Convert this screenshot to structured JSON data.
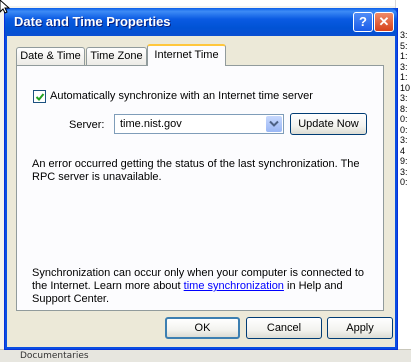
{
  "window": {
    "title": "Date and Time Properties",
    "help_label": "?",
    "close_label": "✕"
  },
  "tabs": [
    {
      "label": "Date & Time",
      "active": false
    },
    {
      "label": "Time Zone",
      "active": false
    },
    {
      "label": "Internet Time",
      "active": true
    }
  ],
  "internet_time": {
    "auto_sync_label": "Automatically synchronize with an Internet time server",
    "auto_sync_checked": true,
    "server_label": "Server:",
    "server_value": "time.nist.gov",
    "update_now_label": "Update Now",
    "error_message": "An error occurred getting the status of the last synchronization.  The RPC server is unavailable.",
    "sync_note_before": "Synchronization can occur only when your computer is connected to the Internet.  Learn more about ",
    "sync_note_link": "time synchronization",
    "sync_note_after": " in Help and Support Center."
  },
  "footer": {
    "ok_label": "OK",
    "cancel_label": "Cancel",
    "apply_label": "Apply"
  },
  "background": {
    "right_edge_chars": [
      "3:",
      "5:",
      "1:",
      "3:",
      "1:",
      "10",
      "3:",
      "8:",
      "0:",
      "0:",
      "3:",
      "4",
      "9:",
      "3:",
      "0:"
    ],
    "bottom_text": "Documentaries"
  },
  "colors": {
    "titlebar": "#0a5ae2",
    "dialog_bg": "#ece9d8",
    "link": "#0000ff",
    "check": "#21a121"
  }
}
